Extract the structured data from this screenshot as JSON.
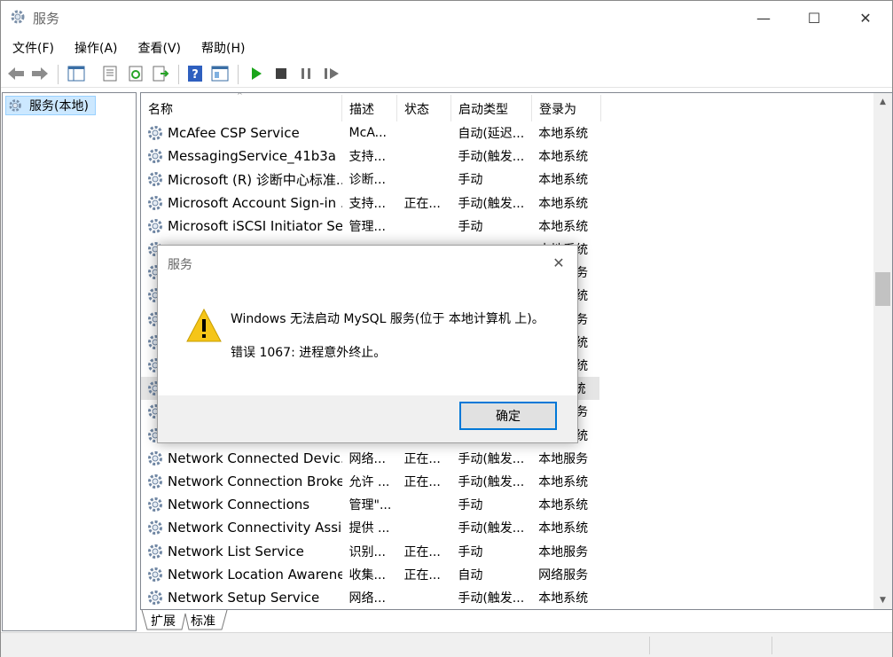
{
  "window": {
    "title": "服务",
    "controls": {
      "minimize": "—",
      "maximize": "☐",
      "close": "✕"
    }
  },
  "menu": [
    "文件(F)",
    "操作(A)",
    "查看(V)",
    "帮助(H)"
  ],
  "toolbar": {
    "icons": [
      "back-arrow-icon",
      "forward-arrow-icon",
      "show-hide-tree-icon",
      "properties-icon",
      "refresh-icon",
      "export-list-icon",
      "help-icon",
      "view-icon",
      "start-service-icon",
      "stop-service-icon",
      "pause-service-icon",
      "restart-service-icon"
    ]
  },
  "tree": {
    "root_label": "服务(本地)"
  },
  "columns": {
    "name": "名称",
    "description": "描述",
    "status": "状态",
    "startup": "启动类型",
    "logon": "登录为"
  },
  "rows": [
    {
      "name": "McAfee CSP Service",
      "description": "McA...",
      "status": "",
      "startup": "自动(延迟...",
      "logon": "本地系统"
    },
    {
      "name": "MessagingService_41b3a",
      "description": "支持...",
      "status": "",
      "startup": "手动(触发...",
      "logon": "本地系统"
    },
    {
      "name": "Microsoft (R) 诊断中心标准...",
      "description": "诊断...",
      "status": "",
      "startup": "手动",
      "logon": "本地系统"
    },
    {
      "name": "Microsoft Account Sign-in ...",
      "description": "支持...",
      "status": "正在...",
      "startup": "手动(触发...",
      "logon": "本地系统"
    },
    {
      "name": "Microsoft iSCSI Initiator Ser...",
      "description": "管理...",
      "status": "",
      "startup": "手动",
      "logon": "本地系统"
    },
    {
      "name": "",
      "description": "",
      "status": "",
      "startup": "",
      "logon": "本地系统"
    },
    {
      "name": "",
      "description": "",
      "status": "",
      "startup": "",
      "logon": "本地服务"
    },
    {
      "name": "",
      "description": "",
      "status": "",
      "startup": "",
      "logon": "本地系统"
    },
    {
      "name": "",
      "description": "",
      "status": "",
      "startup": "",
      "logon": "本地服务"
    },
    {
      "name": "",
      "description": "",
      "status": "",
      "startup": "",
      "logon": "本地系统"
    },
    {
      "name": "",
      "description": "",
      "status": "",
      "startup": "",
      "logon": "本地系统"
    },
    {
      "name": "",
      "description": "",
      "status": "",
      "startup": "",
      "logon": "本地系统"
    },
    {
      "name": "",
      "description": "",
      "status": "",
      "startup": "",
      "logon": "本地服务"
    },
    {
      "name": "",
      "description": "",
      "status": "",
      "startup": "",
      "logon": "本地系统"
    },
    {
      "name": "Network Connected Devic...",
      "description": "网络...",
      "status": "正在...",
      "startup": "手动(触发...",
      "logon": "本地服务"
    },
    {
      "name": "Network Connection Broker",
      "description": "允许 ...",
      "status": "正在...",
      "startup": "手动(触发...",
      "logon": "本地系统"
    },
    {
      "name": "Network Connections",
      "description": "管理\"...",
      "status": "",
      "startup": "手动",
      "logon": "本地系统"
    },
    {
      "name": "Network Connectivity Assis...",
      "description": "提供 ...",
      "status": "",
      "startup": "手动(触发...",
      "logon": "本地系统"
    },
    {
      "name": "Network List Service",
      "description": "识别...",
      "status": "正在...",
      "startup": "手动",
      "logon": "本地服务"
    },
    {
      "name": "Network Location Awarene...",
      "description": "收集...",
      "status": "正在...",
      "startup": "自动",
      "logon": "网络服务"
    },
    {
      "name": "Network Setup Service",
      "description": "网络...",
      "status": "",
      "startup": "手动(触发...",
      "logon": "本地系统"
    }
  ],
  "tabs": {
    "extended": "扩展",
    "standard": "标准"
  },
  "dialog": {
    "title": "服务",
    "message": "Windows 无法启动 MySQL 服务(位于 本地计算机 上)。",
    "error": "错误 1067: 进程意外终止。",
    "ok_label": "确定",
    "close_glyph": "✕"
  },
  "colors": {
    "selection": "#cce8ff",
    "accent": "#0078d7",
    "warning": "#f5c518",
    "play": "#1aa51a"
  }
}
